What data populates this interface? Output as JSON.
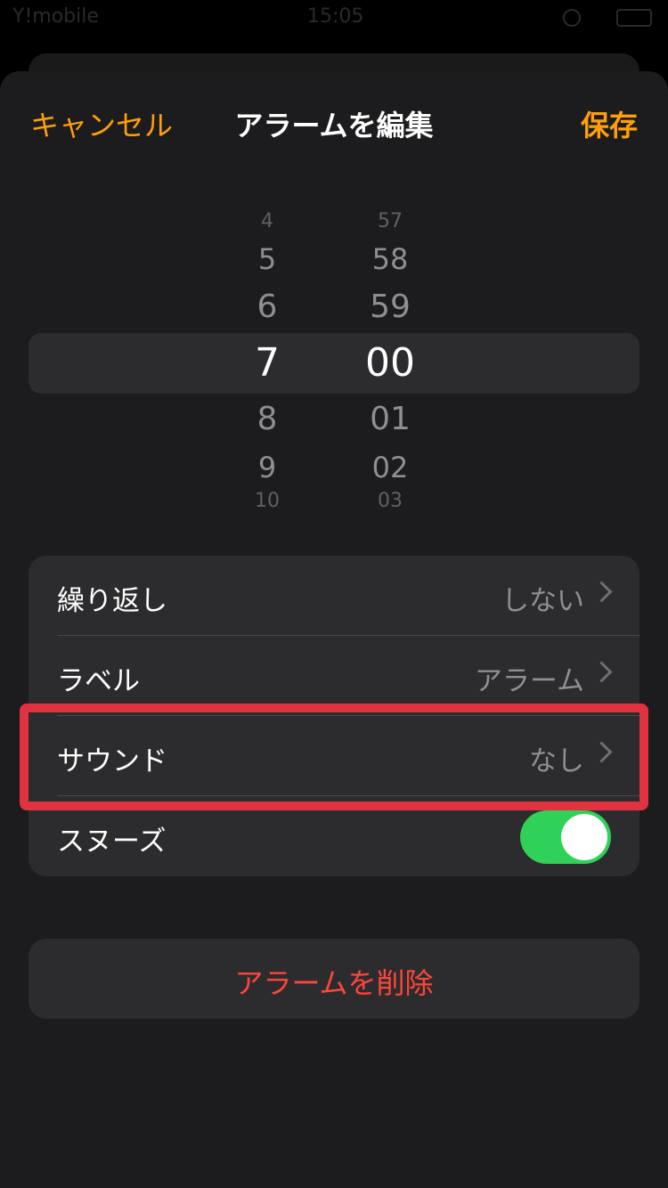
{
  "status_bar": {
    "carrier": "Y!mobile",
    "time": "15:05"
  },
  "nav": {
    "cancel": "キャンセル",
    "title": "アラームを編集",
    "save": "保存"
  },
  "picker": {
    "hours": [
      "4",
      "5",
      "6",
      "7",
      "8",
      "9",
      "10"
    ],
    "minutes": [
      "57",
      "58",
      "59",
      "00",
      "01",
      "02",
      "03"
    ],
    "selected_hour": "7",
    "selected_minute": "00"
  },
  "settings": {
    "repeat": {
      "label": "繰り返し",
      "value": "しない"
    },
    "label": {
      "label": "ラベル",
      "value": "アラーム"
    },
    "sound": {
      "label": "サウンド",
      "value": "なし"
    },
    "snooze": {
      "label": "スヌーズ",
      "enabled": true
    }
  },
  "delete_button": "アラームを削除",
  "colors": {
    "accent": "#ff9f0a",
    "toggle_on": "#30d158",
    "destructive": "#ff453a",
    "highlight": "#e0323f"
  }
}
